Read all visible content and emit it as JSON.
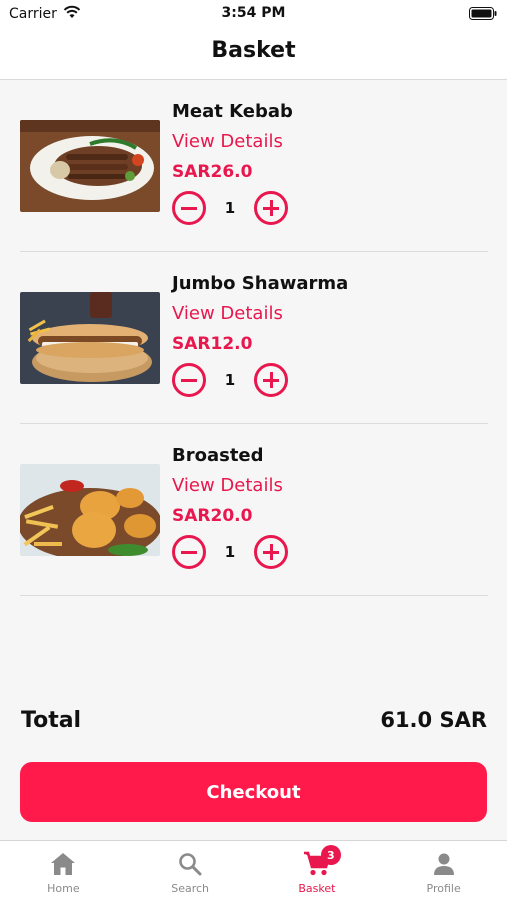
{
  "status": {
    "carrier": "Carrier",
    "time": "3:54 PM"
  },
  "header": {
    "title": "Basket"
  },
  "items": [
    {
      "name": "Meat Kebab",
      "details": "View Details",
      "price": "SAR26.0",
      "qty": "1"
    },
    {
      "name": "Jumbo Shawarma",
      "details": "View Details",
      "price": "SAR12.0",
      "qty": "1"
    },
    {
      "name": "Broasted",
      "details": "View Details",
      "price": "SAR20.0",
      "qty": "1"
    }
  ],
  "summary": {
    "total_label": "Total",
    "total_value": "61.0 SAR"
  },
  "checkout": {
    "label": "Checkout"
  },
  "tabs": [
    {
      "label": "Home",
      "icon": "home-icon"
    },
    {
      "label": "Search",
      "icon": "search-icon"
    },
    {
      "label": "Basket",
      "icon": "cart-icon",
      "badge": "3"
    },
    {
      "label": "Profile",
      "icon": "person-icon"
    }
  ],
  "colors": {
    "accent": "#e8174d",
    "checkout": "#ff1a4b",
    "inactive": "#8a8a8a"
  }
}
